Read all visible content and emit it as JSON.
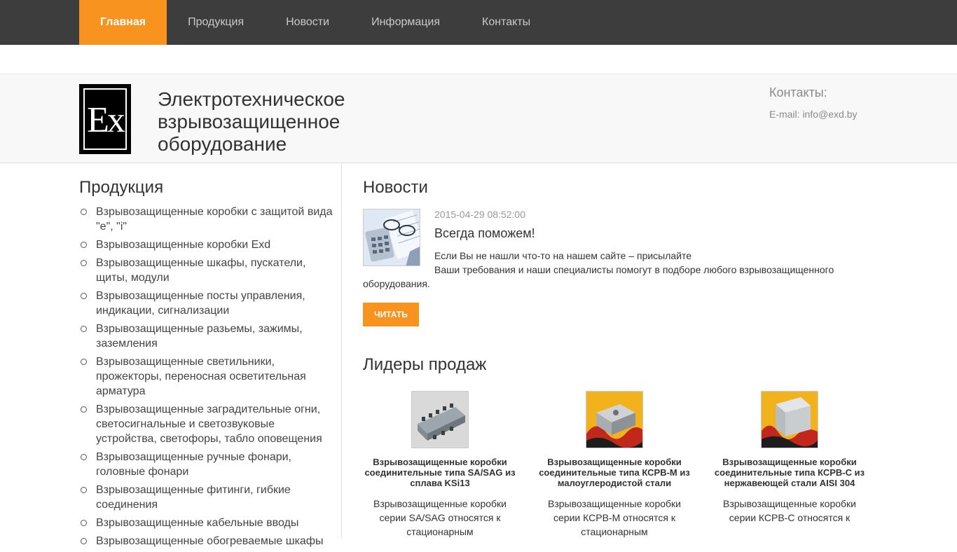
{
  "nav": {
    "items": [
      {
        "label": "Главная",
        "active": true
      },
      {
        "label": "Продукция",
        "active": false
      },
      {
        "label": "Новости",
        "active": false
      },
      {
        "label": "Информация",
        "active": false
      },
      {
        "label": "Контакты",
        "active": false
      }
    ]
  },
  "header": {
    "logo_text": "Ex",
    "title": "Электротехническое взрывозащищенное оборудование",
    "contacts_heading": "Контакты:",
    "email": "E-mail: info@exd.by"
  },
  "sidebar": {
    "heading": "Продукция",
    "items": [
      "Взрывозащищенные коробки с защитой вида \"e\", \"i\"",
      "Взрывозащищенные коробки Exd",
      "Взрывозащищенные шкафы, пускатели, щиты, модули",
      "Взрывозащищенные посты управления, индикации, сигнализации",
      "Взрывозащищенные разьемы, зажимы, заземления",
      "Взрывозащищенные светильники, прожекторы, переносная осветительная арматура",
      "Взрывозащищенные заградительные огни, светосигнальные и светозвуковые устройства, светофоры, табло оповещения",
      "Взрывозащищенные ручные фонари, головные фонари",
      "Взрывозащищенные фитинги, гибкие соединения",
      "Взрывозащищенные кабельные вводы",
      "Взрывозащищенные обогреваемые шкафы"
    ]
  },
  "news": {
    "heading": "Новости",
    "date": "2015-04-29 08:52:00",
    "title": "Всегда поможем!",
    "text1": "Если Вы не нашли что-то на нашем сайте – присылайте",
    "text2": "Ваши требования и наши специалисты помогут в подборе любого взрывозащищенного оборудования.",
    "read_label": "ЧИТАТЬ"
  },
  "leaders": {
    "heading": "Лидеры продаж",
    "products": [
      {
        "title": "Взрывозащищенные коробки соединительные типа SA/SAG из сплава KSi13",
        "desc": "Взрывозащищенные коробки серии SA/SAG относятся к стационарным"
      },
      {
        "title": "Взрывозащищенные коробки соединительные типа КСРВ-М из малоуглеродистой стали",
        "desc": "Взрывозащищенные коробки серии КСРВ-М относятся к стационарным"
      },
      {
        "title": "Взрывозащищенные коробки соединительные типа КСРВ-С из нержавеющей стали AISI 304",
        "desc": "Взрывозащищенные коробки серии КСРВ-С относятся к"
      }
    ]
  },
  "colors": {
    "accent": "#f7931e",
    "nav_bg": "#3d3d3d",
    "header_bg": "#f8f8f8"
  }
}
